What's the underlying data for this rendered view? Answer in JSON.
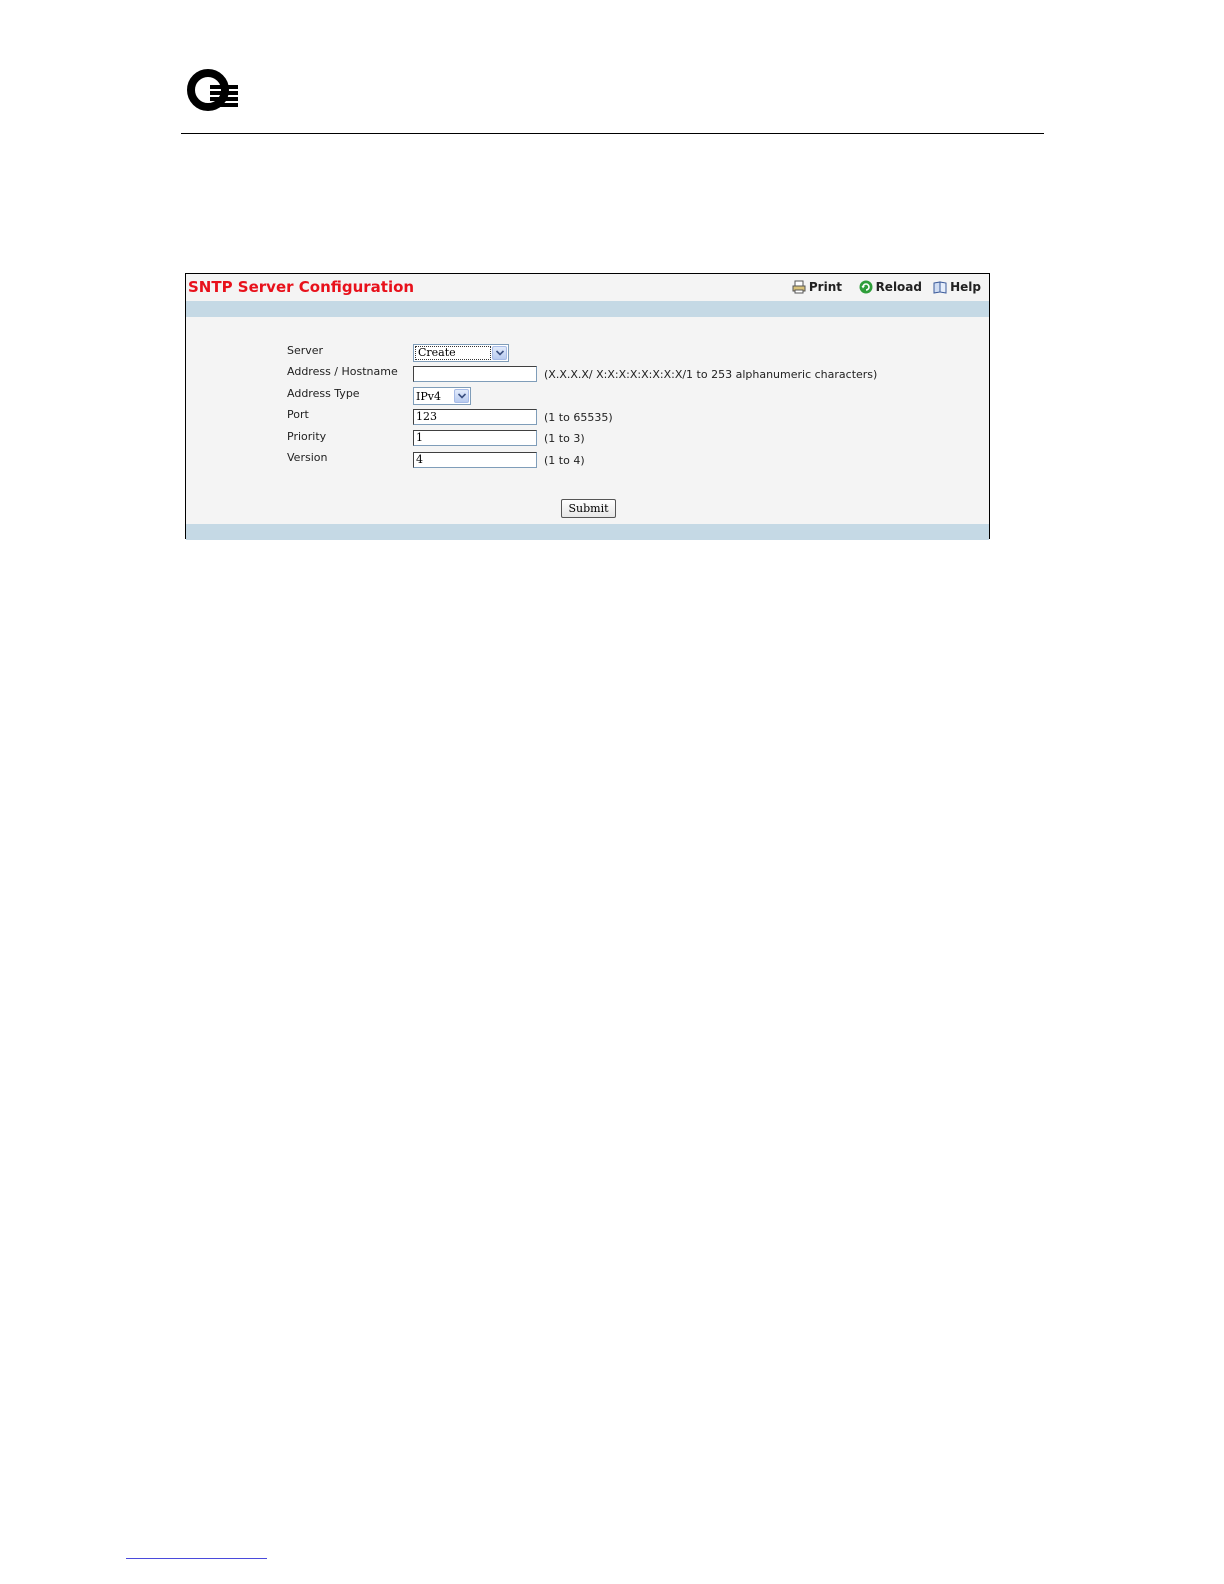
{
  "panel": {
    "title": "SNTP Server Configuration",
    "toolbar": {
      "print": "Print",
      "reload": "Reload",
      "help": "Help"
    }
  },
  "form": {
    "server": {
      "label": "Server",
      "value": "Create"
    },
    "address": {
      "label": "Address / Hostname",
      "value": "",
      "hint": "(X.X.X.X/ X:X:X:X:X:X:X:X/1 to 253 alphanumeric characters)"
    },
    "address_type": {
      "label": "Address Type",
      "value": "IPv4"
    },
    "port": {
      "label": "Port",
      "value": "123",
      "hint": "(1 to 65535)"
    },
    "priority": {
      "label": "Priority",
      "value": "1",
      "hint": "(1 to 3)"
    },
    "version": {
      "label": "Version",
      "value": "4",
      "hint": "(1 to 4)"
    },
    "submit_label": "Submit"
  },
  "colors": {
    "title": "#e8111b",
    "band": "#c5d9e5",
    "panel_bg": "#f4f4f4"
  },
  "icons": [
    "logo-icon",
    "printer-icon",
    "reload-icon",
    "help-book-icon",
    "chevron-down-icon"
  ]
}
